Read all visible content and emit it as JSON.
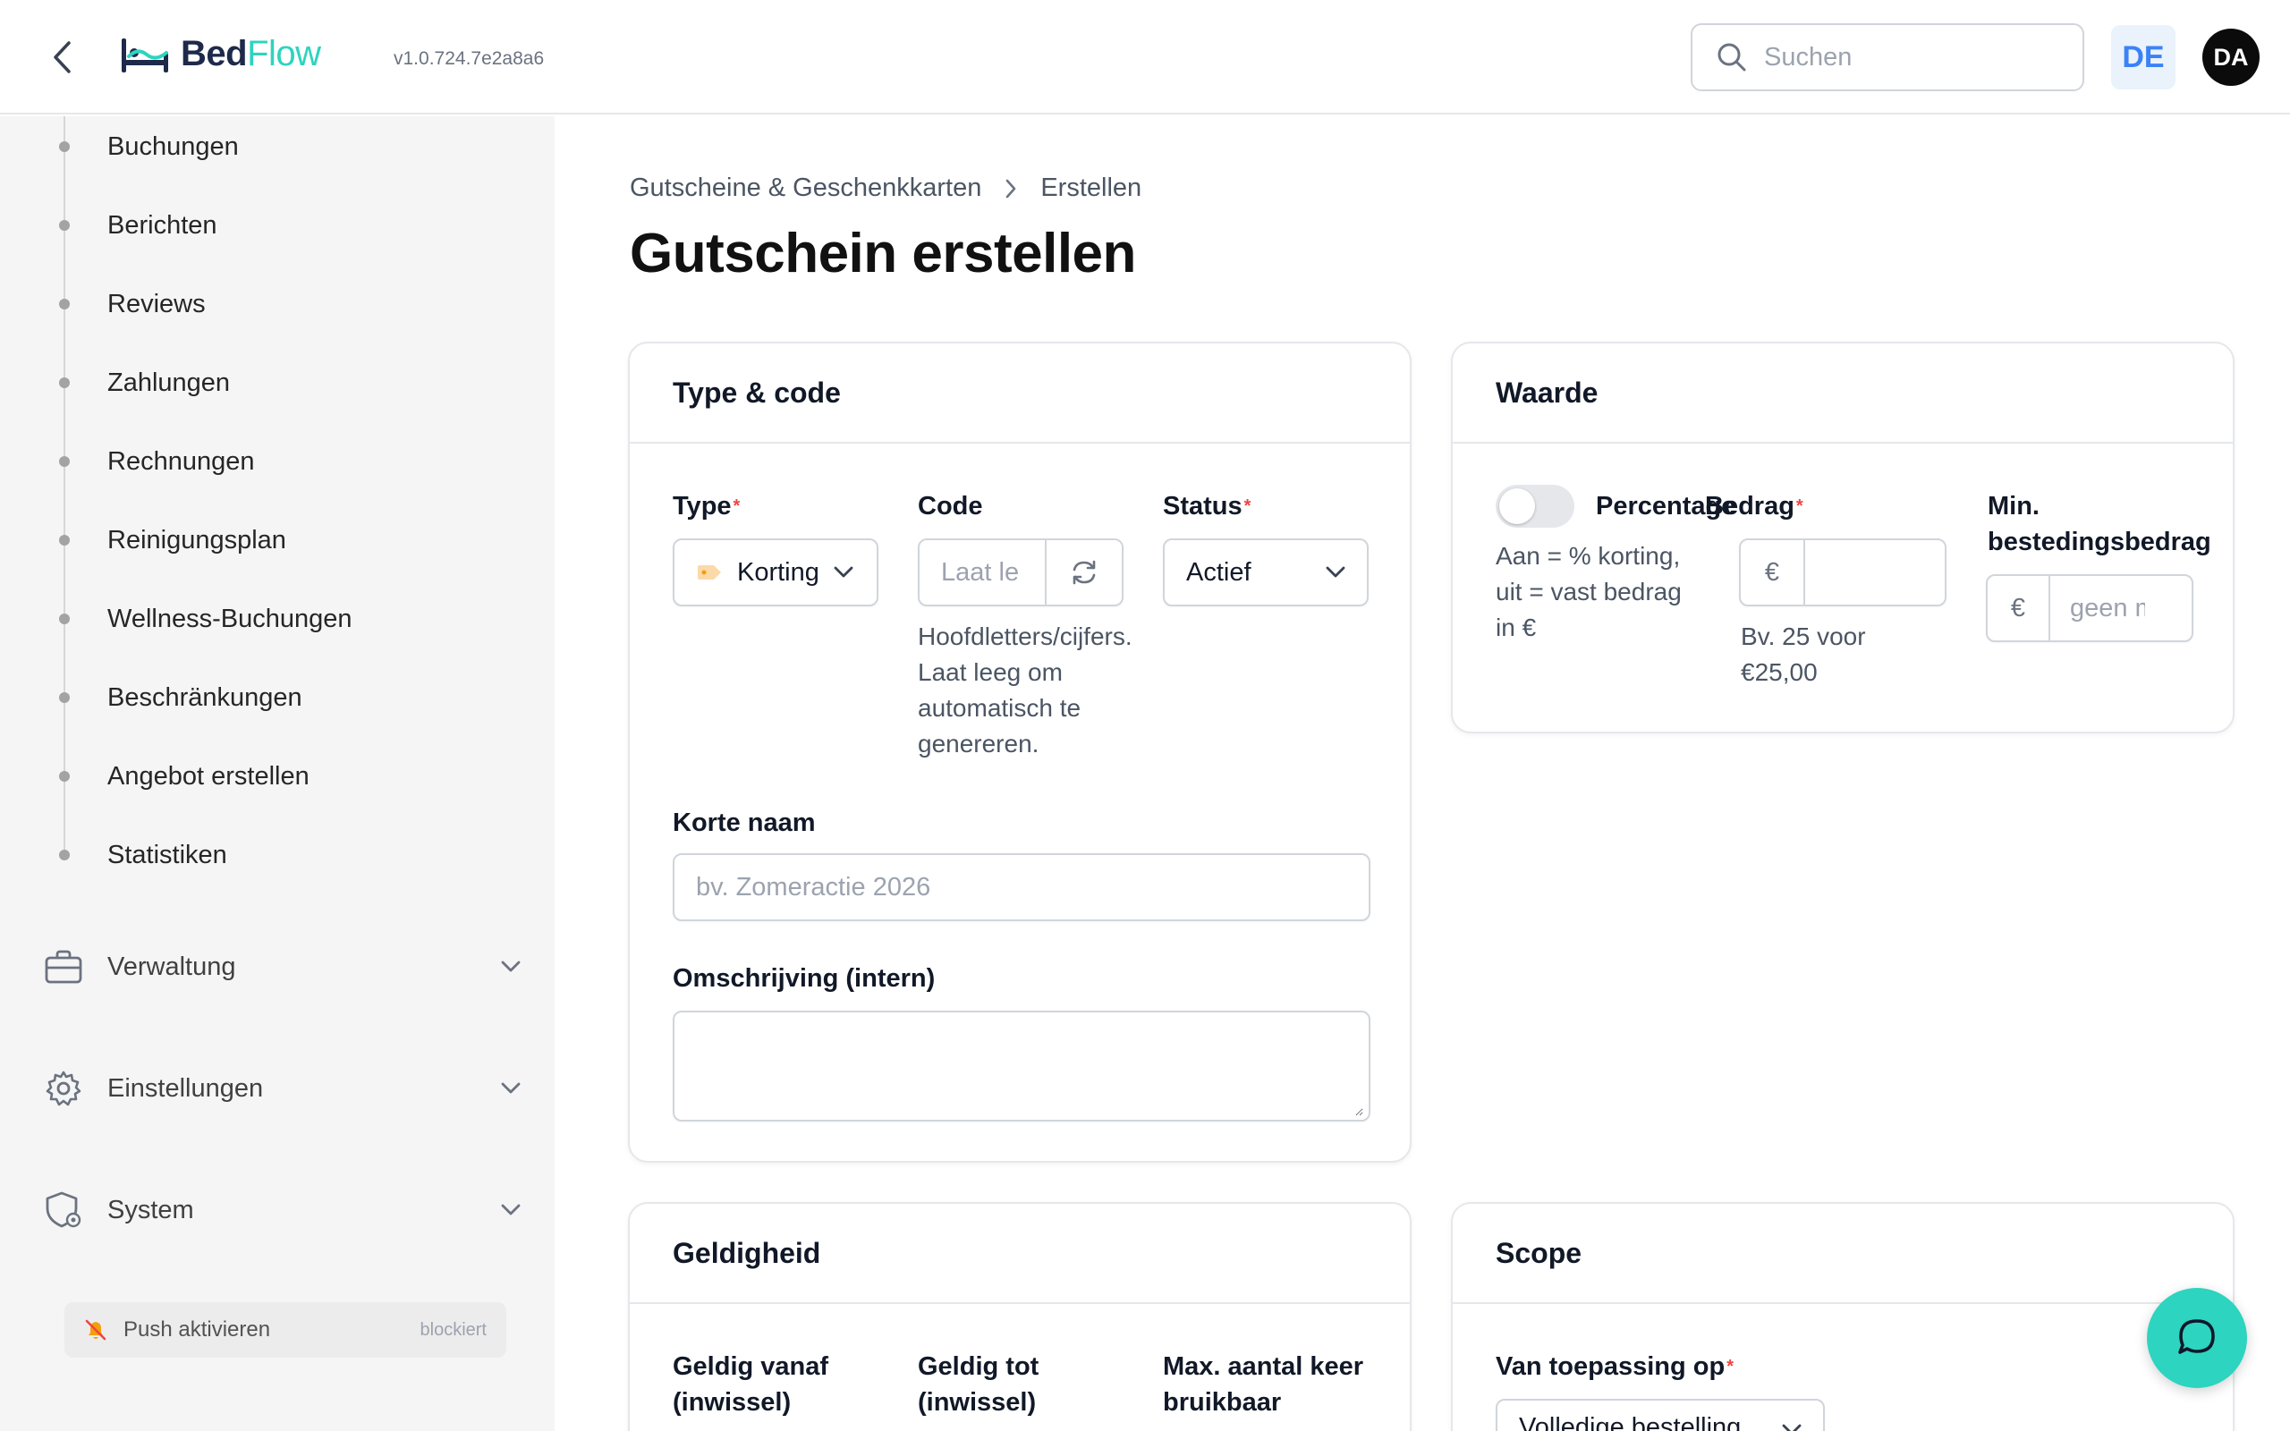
{
  "header": {
    "brand_part1": "Bed",
    "brand_part2": "Flow",
    "version": "v1.0.724.7e2a8a6",
    "search_placeholder": "Suchen",
    "language": "DE",
    "user_initials": "DA"
  },
  "sidebar": {
    "sub_items": [
      "Buchungen",
      "Berichten",
      "Reviews",
      "Zahlungen",
      "Rechnungen",
      "Reinigungsplan",
      "Wellness-Buchungen",
      "Beschränkungen",
      "Angebot erstellen",
      "Statistiken"
    ],
    "groups": [
      {
        "label": "Verwaltung",
        "icon": "briefcase-icon"
      },
      {
        "label": "Einstellungen",
        "icon": "gear-icon"
      },
      {
        "label": "System",
        "icon": "shield-gear-icon"
      }
    ],
    "push": {
      "label": "Push aktivieren",
      "status": "blockiert"
    }
  },
  "breadcrumb": {
    "parent": "Gutscheine & Geschenkkarten",
    "current": "Erstellen"
  },
  "page_title": "Gutschein erstellen",
  "type_code": {
    "title": "Type & code",
    "type_label": "Type",
    "type_value": "Korting",
    "code_label": "Code",
    "code_placeholder": "Laat le",
    "code_hint_lines": [
      "Hoofdletters/cijfers.",
      "Laat leeg om",
      "automatisch te",
      "genereren."
    ],
    "status_label": "Status",
    "status_value": "Actief",
    "short_name_label": "Korte naam",
    "short_name_placeholder": "bv. Zomeractie 2026",
    "description_label": "Omschrijving (intern)"
  },
  "value_card": {
    "title": "Waarde",
    "percentage_label": "Percentage",
    "percentage_hint_lines": [
      "Aan = % korting,",
      "uit = vast bedrag",
      "in €"
    ],
    "amount_label": "Bedrag",
    "amount_hint_lines": [
      "Bv. 25 voor",
      "€25,00"
    ],
    "min_label_lines": [
      "Min.",
      "bestedingsbedrag"
    ],
    "currency": "€",
    "min_placeholder": "geen m"
  },
  "validity_card": {
    "title": "Geldigheid",
    "from_label_lines": [
      "Geldig vanaf",
      "(inwissel)"
    ],
    "to_label_lines": [
      "Geldig tot",
      "(inwissel)"
    ],
    "max_label_lines": [
      "Max. aantal keer",
      "bruikbaar"
    ]
  },
  "scope_card": {
    "title": "Scope",
    "applies_label": "Van toepassing op",
    "applies_value": "Volledige bestelling"
  }
}
